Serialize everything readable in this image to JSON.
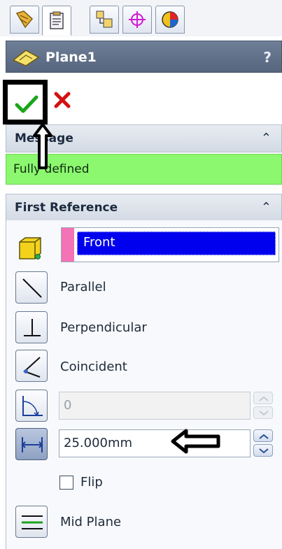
{
  "tabs": [
    {
      "icon": "feature-manager-icon"
    },
    {
      "icon": "property-manager-icon",
      "active": true
    },
    {
      "icon": "configuration-manager-icon"
    },
    {
      "icon": "dim-xpert-icon"
    },
    {
      "icon": "display-manager-icon"
    }
  ],
  "header": {
    "title": "Plane1",
    "help": "?"
  },
  "actions": {
    "ok_icon": "checkmark-icon",
    "cancel_icon": "close-icon"
  },
  "message": {
    "title": "Message",
    "collapse": "⌃",
    "text": "Fully defined"
  },
  "first_reference": {
    "title": "First Reference",
    "collapse": "⌃",
    "selection": "Front",
    "options": [
      {
        "label": "Parallel"
      },
      {
        "label": "Perpendicular"
      },
      {
        "label": "Coincident"
      }
    ],
    "angle_value": "0",
    "distance_value": "25.000mm",
    "flip_label": "Flip",
    "mid_plane_label": "Mid Plane"
  },
  "colors": {
    "message_bg": "#8cf870",
    "selection_bg": "#0000ee",
    "selection_swatch": "#f472b6",
    "title_bar": "#5f6f87"
  }
}
